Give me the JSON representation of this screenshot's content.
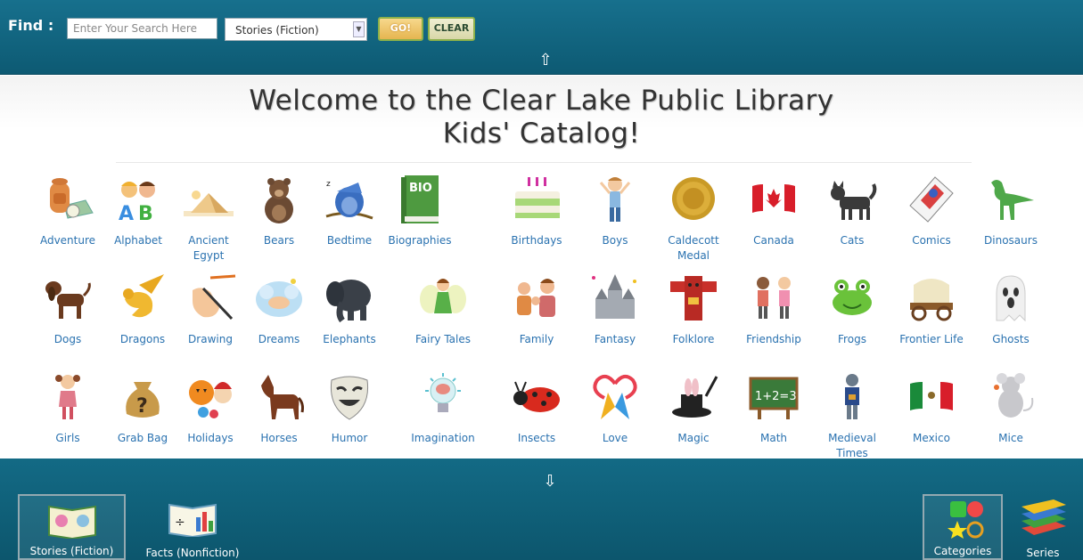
{
  "search": {
    "find_label": "Find :",
    "placeholder": "Enter Your Search Here",
    "select_value": "Stories (Fiction)",
    "go_label": "GO!",
    "clear_label": "CLEAR"
  },
  "header": {
    "title_line1": "Welcome to the Clear Lake Public Library",
    "title_line2": "Kids' Catalog!"
  },
  "categories": [
    {
      "label": "Adventure",
      "icon": "backpack-icon"
    },
    {
      "label": "Alphabet",
      "icon": "alphabet-kids-icon"
    },
    {
      "label": "Ancient Egypt",
      "icon": "pyramid-icon"
    },
    {
      "label": "Bears",
      "icon": "bear-icon"
    },
    {
      "label": "Bedtime",
      "icon": "sleeping-owl-icon"
    },
    {
      "label": "Biographies",
      "icon": "bio-book-icon"
    },
    {
      "label": "Birthdays",
      "icon": "birthday-cake-icon"
    },
    {
      "label": "Boys",
      "icon": "boy-icon"
    },
    {
      "label": "Caldecott Medal",
      "icon": "gold-medal-icon"
    },
    {
      "label": "Canada",
      "icon": "canada-flag-icon"
    },
    {
      "label": "Cats",
      "icon": "cat-icon"
    },
    {
      "label": "Comics",
      "icon": "comic-book-icon"
    },
    {
      "label": "Dinosaurs",
      "icon": "dinosaur-icon"
    },
    {
      "label": "Dogs",
      "icon": "dog-icon"
    },
    {
      "label": "Dragons",
      "icon": "dragon-icon"
    },
    {
      "label": "Drawing",
      "icon": "drawing-hand-icon"
    },
    {
      "label": "Dreams",
      "icon": "dreaming-baby-icon"
    },
    {
      "label": "Elephants",
      "icon": "elephant-icon"
    },
    {
      "label": "Fairy Tales",
      "icon": "fairy-icon"
    },
    {
      "label": "Family",
      "icon": "family-icon"
    },
    {
      "label": "Fantasy",
      "icon": "castle-icon"
    },
    {
      "label": "Folklore",
      "icon": "totem-icon"
    },
    {
      "label": "Friendship",
      "icon": "friends-icon"
    },
    {
      "label": "Frogs",
      "icon": "frog-icon"
    },
    {
      "label": "Frontier Life",
      "icon": "covered-wagon-icon"
    },
    {
      "label": "Ghosts",
      "icon": "ghost-icon"
    },
    {
      "label": "Girls",
      "icon": "girl-icon"
    },
    {
      "label": "Grab Bag",
      "icon": "grab-bag-icon"
    },
    {
      "label": "Holidays",
      "icon": "holidays-icon"
    },
    {
      "label": "Horses",
      "icon": "horse-icon"
    },
    {
      "label": "Humor",
      "icon": "comedy-mask-icon"
    },
    {
      "label": "Imagination",
      "icon": "lightbulb-brain-icon"
    },
    {
      "label": "Insects",
      "icon": "ladybug-icon"
    },
    {
      "label": "Love",
      "icon": "love-heart-icon"
    },
    {
      "label": "Magic",
      "icon": "magic-hat-icon"
    },
    {
      "label": "Math",
      "icon": "chalkboard-math-icon"
    },
    {
      "label": "Medieval Times",
      "icon": "knight-icon"
    },
    {
      "label": "Mexico",
      "icon": "mexico-flag-icon"
    },
    {
      "label": "Mice",
      "icon": "mouse-icon"
    }
  ],
  "math_board_text": "1+2=3",
  "bio_book_text": "BIO",
  "bottom_tabs": {
    "stories": "Stories (Fiction)",
    "facts": "Facts (Nonfiction)",
    "categories": "Categories",
    "series": "Series"
  },
  "colors": {
    "bar": "#0f6480",
    "link": "#2a72b0"
  }
}
